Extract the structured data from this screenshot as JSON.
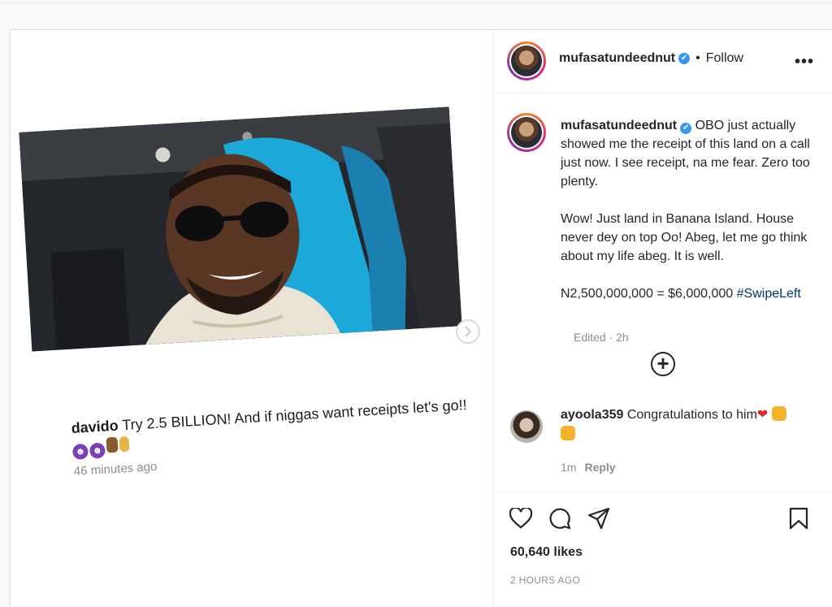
{
  "header": {
    "username": "mufasatundeednut",
    "verified_glyph": "✔",
    "separator": "•",
    "follow_label": "Follow",
    "more_label": "•••"
  },
  "media": {
    "caption_user": "davido",
    "caption_text": " Try 2.5 BILLION! And if niggas want receipts let's go!!",
    "caption_time": "46 minutes ago"
  },
  "caption": {
    "username": "mufasatundeednut",
    "paragraphs": [
      "OBO just actually showed me the receipt of this land on a call just now. I see receipt, na me fear. Zero too plenty.",
      "Wow! Just land in Banana Island. House never dey on top Oo! Abeg, let me go think about my life abeg. It is well."
    ],
    "amount_text": "N2,500,000,000 = $6,000,000 ",
    "hashtag": "#SwipeLeft",
    "edited": "Edited · 2h"
  },
  "comment": {
    "username": "ayoola359",
    "text": " Congratulations to him",
    "heart": "❤",
    "time": "1m",
    "reply_label": "Reply"
  },
  "actions": {
    "likes": "60,640 likes",
    "post_time": "2 HOURS AGO"
  },
  "icons": [
    "heart-icon",
    "comment-icon",
    "share-icon",
    "bookmark-icon",
    "add-circle-icon",
    "chevron-right-icon",
    "more-icon"
  ],
  "colors": {
    "link": "#00376b",
    "verified": "#3897f0",
    "muted": "#8e8e8e",
    "border": "#dbdbdb"
  }
}
